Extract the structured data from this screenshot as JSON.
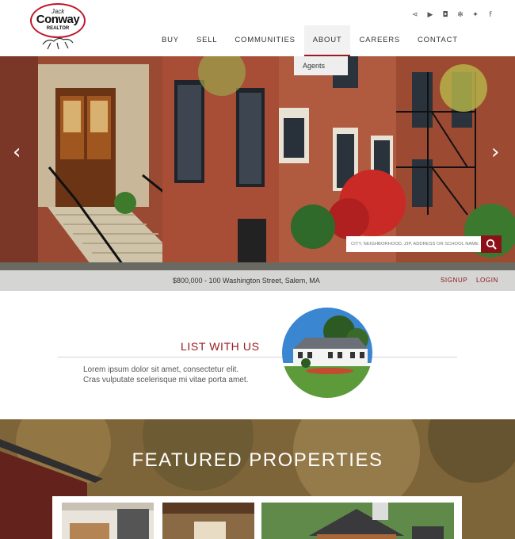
{
  "logo": {
    "line1": "Jack",
    "line2": "Conway",
    "line3": "REALTOR",
    "brand_color": "#c0182c"
  },
  "social": [
    {
      "icon": "share-icon",
      "glyph": "⋖"
    },
    {
      "icon": "youtube-icon",
      "glyph": "▶"
    },
    {
      "icon": "instagram-icon",
      "glyph": "◘"
    },
    {
      "icon": "yelp-icon",
      "glyph": "✻"
    },
    {
      "icon": "twitter-icon",
      "glyph": "✦"
    },
    {
      "icon": "facebook-icon",
      "glyph": "f"
    }
  ],
  "nav": {
    "items": [
      {
        "label": "BUY"
      },
      {
        "label": "SELL"
      },
      {
        "label": "COMMUNITIES"
      },
      {
        "label": "ABOUT",
        "active": true
      },
      {
        "label": "CAREERS"
      },
      {
        "label": "CONTACT"
      }
    ],
    "dropdown_item": "Agents",
    "accent_color": "#9b1b20"
  },
  "hero": {
    "search_placeholder": "CITY, NEIGHBORHOOD, ZIP, ADDRESS OR SCHOOL NAME",
    "address": "$800,000 - 100 Washington Street, Salem, MA",
    "signup": "SIGNUP",
    "login": "LOGIN",
    "prev_icon": "chevron-left-icon",
    "next_icon": "chevron-right-icon"
  },
  "list_section": {
    "title": "LIST WITH US",
    "body_line1": "Lorem ipsum dolor sit amet, consectetur elit.",
    "body_line2": "Cras vulputate scelerisque mi vitae porta amet."
  },
  "featured": {
    "title": "FEATURED PROPERTIES"
  }
}
